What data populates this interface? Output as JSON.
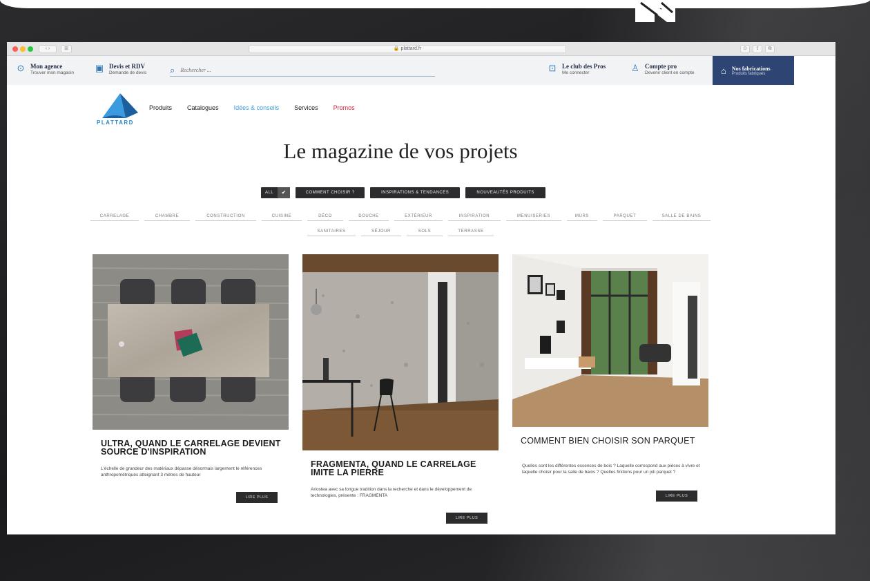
{
  "browser": {
    "url": "plattard.fr",
    "tab_indicator": "⊞"
  },
  "top_bar": {
    "agence": {
      "title": "Mon agence",
      "subtitle": "Trouver mon magasin"
    },
    "devis": {
      "title": "Devis et RDV",
      "subtitle": "Demande de devis"
    },
    "search": {
      "placeholder": "Rechercher ..."
    },
    "club": {
      "title": "Le club des Pros",
      "subtitle": "Me connecter"
    },
    "compte": {
      "title": "Compte pro",
      "subtitle": "Devenir client en compte"
    },
    "fabrications": {
      "title": "Nos fabrications",
      "subtitle": "Produits fabriqués"
    }
  },
  "logo": {
    "text": "PLATTARD"
  },
  "nav": {
    "produits": "Produits",
    "catalogues": "Catalogues",
    "idees": "Idées & conseils",
    "services": "Services",
    "promos": "Promos"
  },
  "headline": "Le magazine de vos projets",
  "filters": {
    "all": "ALL",
    "check": "✔",
    "comment": "COMMENT CHOISIR ?",
    "inspirations": "INSPIRATIONS & TENDANCES",
    "nouveautes": "NOUVEAUTÉS PRODUITS"
  },
  "tags_row1": [
    "CARRELAGE",
    "CHAMBRE",
    "CONSTRUCTION",
    "CUISINE",
    "DÉCO",
    "DOUCHE",
    "EXTÉRIEUR",
    "INSPIRATION",
    "MENUISERIES",
    "MURS",
    "PARQUET",
    "SALLE DE BAINS"
  ],
  "tags_row2": [
    "SANITAIRES",
    "SÉJOUR",
    "SOLS",
    "TERRASSE"
  ],
  "cards": [
    {
      "title": "ULTRA, QUAND LE CARRELAGE DEVIENT SOURCE D'INSPIRATION",
      "text": "L'échelle de grandeur des matériaux dépasse désormais largement le références anthropométriques atteignant 3 mètres de hauteur",
      "button": "LIRE PLUS"
    },
    {
      "title": "FRAGMENTA, QUAND LE CARRELAGE IMITE LA PIERRE",
      "text": "Ariostea avec sa longue tradition dans la recherche et dans le développement de technologies, présente : FRAGMENTA",
      "button": "LIRE PLUS"
    },
    {
      "title": "COMMENT BIEN CHOISIR SON PARQUET",
      "text": "Quelles sont les différentes essences de bois ? Laquelle correspond aux pièces à vivre et laquelle choisir pour la salle de bains ? Quelles finitions pour un joli parquet ?",
      "button": "LIRE PLUS"
    }
  ],
  "colors": {
    "accent_blue": "#2f78b5",
    "nav_highlight": "#3d9ed9",
    "promo_red": "#d4233c",
    "fabrication_bg": "#2e4472",
    "button_dark": "#2c2c2e"
  }
}
